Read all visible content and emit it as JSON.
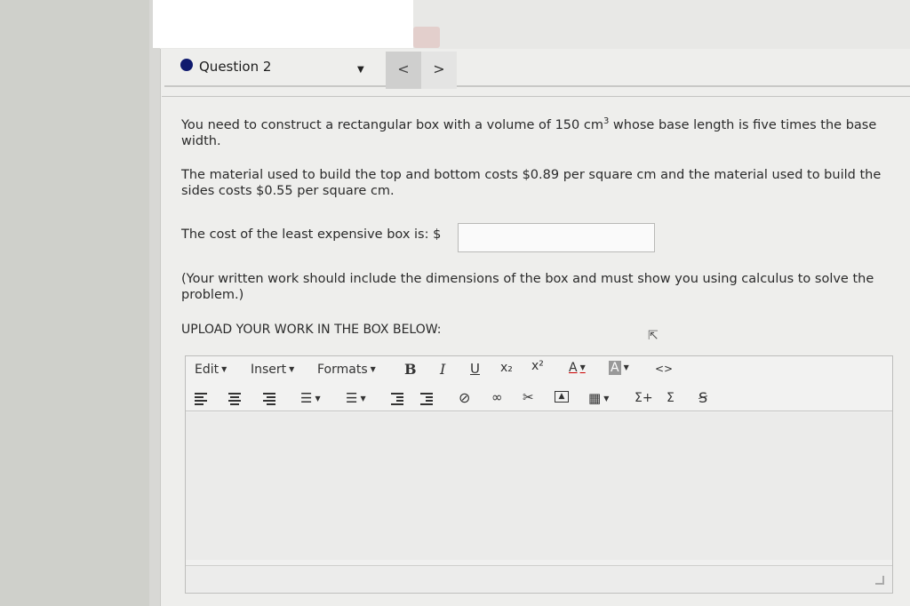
{
  "question": {
    "label": "Question 2"
  },
  "nav": {
    "prev": "<",
    "next": ">"
  },
  "body": {
    "p1_a": "You need to construct a rectangular box with a volume of 150 cm",
    "p1_sup": "3",
    "p1_b": " whose base length is five times the base width.",
    "p2": "The material used to build the top and bottom costs $0.89 per square cm and the material used to build the sides costs $0.55 per square cm.",
    "p3_label": "The cost of the least expensive box is: $",
    "answer_value": "",
    "p4": "(Your written work should include the dimensions of the box and must show you using calculus to solve the problem.)",
    "upload_label": "UPLOAD YOUR WORK IN THE BOX BELOW:"
  },
  "toolbar": {
    "edit": "Edit",
    "insert": "Insert",
    "formats": "Formats",
    "bold": "B",
    "italic": "I",
    "underline": "U",
    "subscript": "x₂",
    "superscript": "x²",
    "font_color": "A",
    "bg_color": "A",
    "code": "<>",
    "sum_plus": "Σ+",
    "sum": "Σ",
    "special": "Ꞩ"
  }
}
